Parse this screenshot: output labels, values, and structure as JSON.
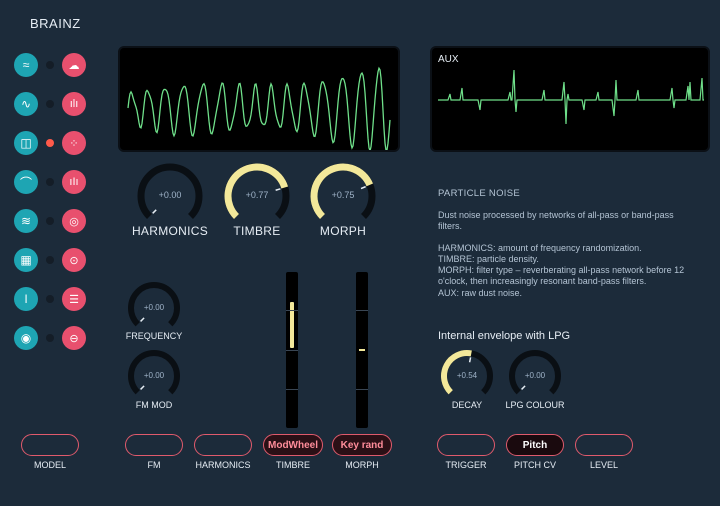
{
  "app": {
    "title": "BRAINZ"
  },
  "models": [
    {
      "left_icon": "bezier-curve-icon",
      "right_icon": "cloud-icon",
      "active": false
    },
    {
      "left_icon": "sine-wave-icon",
      "right_icon": "harmonics-bars-icon",
      "active": false
    },
    {
      "left_icon": "chord-icon",
      "right_icon": "grains-icon",
      "active": true
    },
    {
      "left_icon": "filter-curve-icon",
      "right_icon": "noise-bars-icon",
      "active": false
    },
    {
      "left_icon": "wavetable-icon",
      "right_icon": "concentric-rings-icon",
      "active": false
    },
    {
      "left_icon": "grid-icon",
      "right_icon": "drum-icon",
      "active": false
    },
    {
      "left_icon": "speech-icon",
      "right_icon": "snare-icon",
      "active": false
    },
    {
      "left_icon": "head-icon",
      "right_icon": "hihat-icon",
      "active": false
    }
  ],
  "scopes": {
    "main_label": "",
    "aux_label": "AUX"
  },
  "knobs": {
    "harmonics": {
      "label": "HARMONICS",
      "value": "+0.00",
      "level": 0.0
    },
    "timbre": {
      "label": "TIMBRE",
      "value": "+0.77",
      "level": 0.77
    },
    "morph": {
      "label": "MORPH",
      "value": "+0.75",
      "level": 0.75
    },
    "frequency": {
      "label": "FREQUENCY",
      "value": "+0.00",
      "level": 0.0
    },
    "fm_mod": {
      "label": "FM MOD",
      "value": "+0.00",
      "level": 0.0
    },
    "decay": {
      "label": "DECAY",
      "value": "+0.54",
      "level": 0.54
    },
    "lpg_colour": {
      "label": "LPG COLOUR",
      "value": "+0.00",
      "level": 0.0
    }
  },
  "sliders": {
    "timbre_level": 0.36,
    "morph_level": 0.0
  },
  "info": {
    "title": "PARTICLE NOISE",
    "desc": "Dust noise processed by networks of all-pass or band-pass filters.",
    "line_harmonics": "HARMONICS:  amount of frequency randomization.",
    "line_timbre": "TIMBRE:  particle density.",
    "line_morph": "MORPH:  filter type – reverberating all-pass network before 12 o'clock, then increasingly resonant band-pass filters.",
    "line_aux": "AUX:  raw dust noise."
  },
  "envelope": {
    "title": "Internal envelope with LPG"
  },
  "ports": [
    {
      "text": "",
      "label": "MODEL"
    },
    {
      "text": "",
      "label": "FM"
    },
    {
      "text": "",
      "label": "HARMONICS"
    },
    {
      "text": "ModWheel",
      "label": "TIMBRE"
    },
    {
      "text": "Key rand",
      "label": "MORPH"
    },
    {
      "text": "",
      "label": "TRIGGER"
    },
    {
      "text": "Pitch",
      "label": "PITCH CV"
    },
    {
      "text": "",
      "label": "LEVEL"
    }
  ],
  "colors": {
    "accent_teal": "#1ea5b3",
    "accent_pink": "#e8506e",
    "knob_arc": "#f3e89a",
    "scope_trace": "#6fe08a",
    "active_dot": "#ff5a4a"
  }
}
